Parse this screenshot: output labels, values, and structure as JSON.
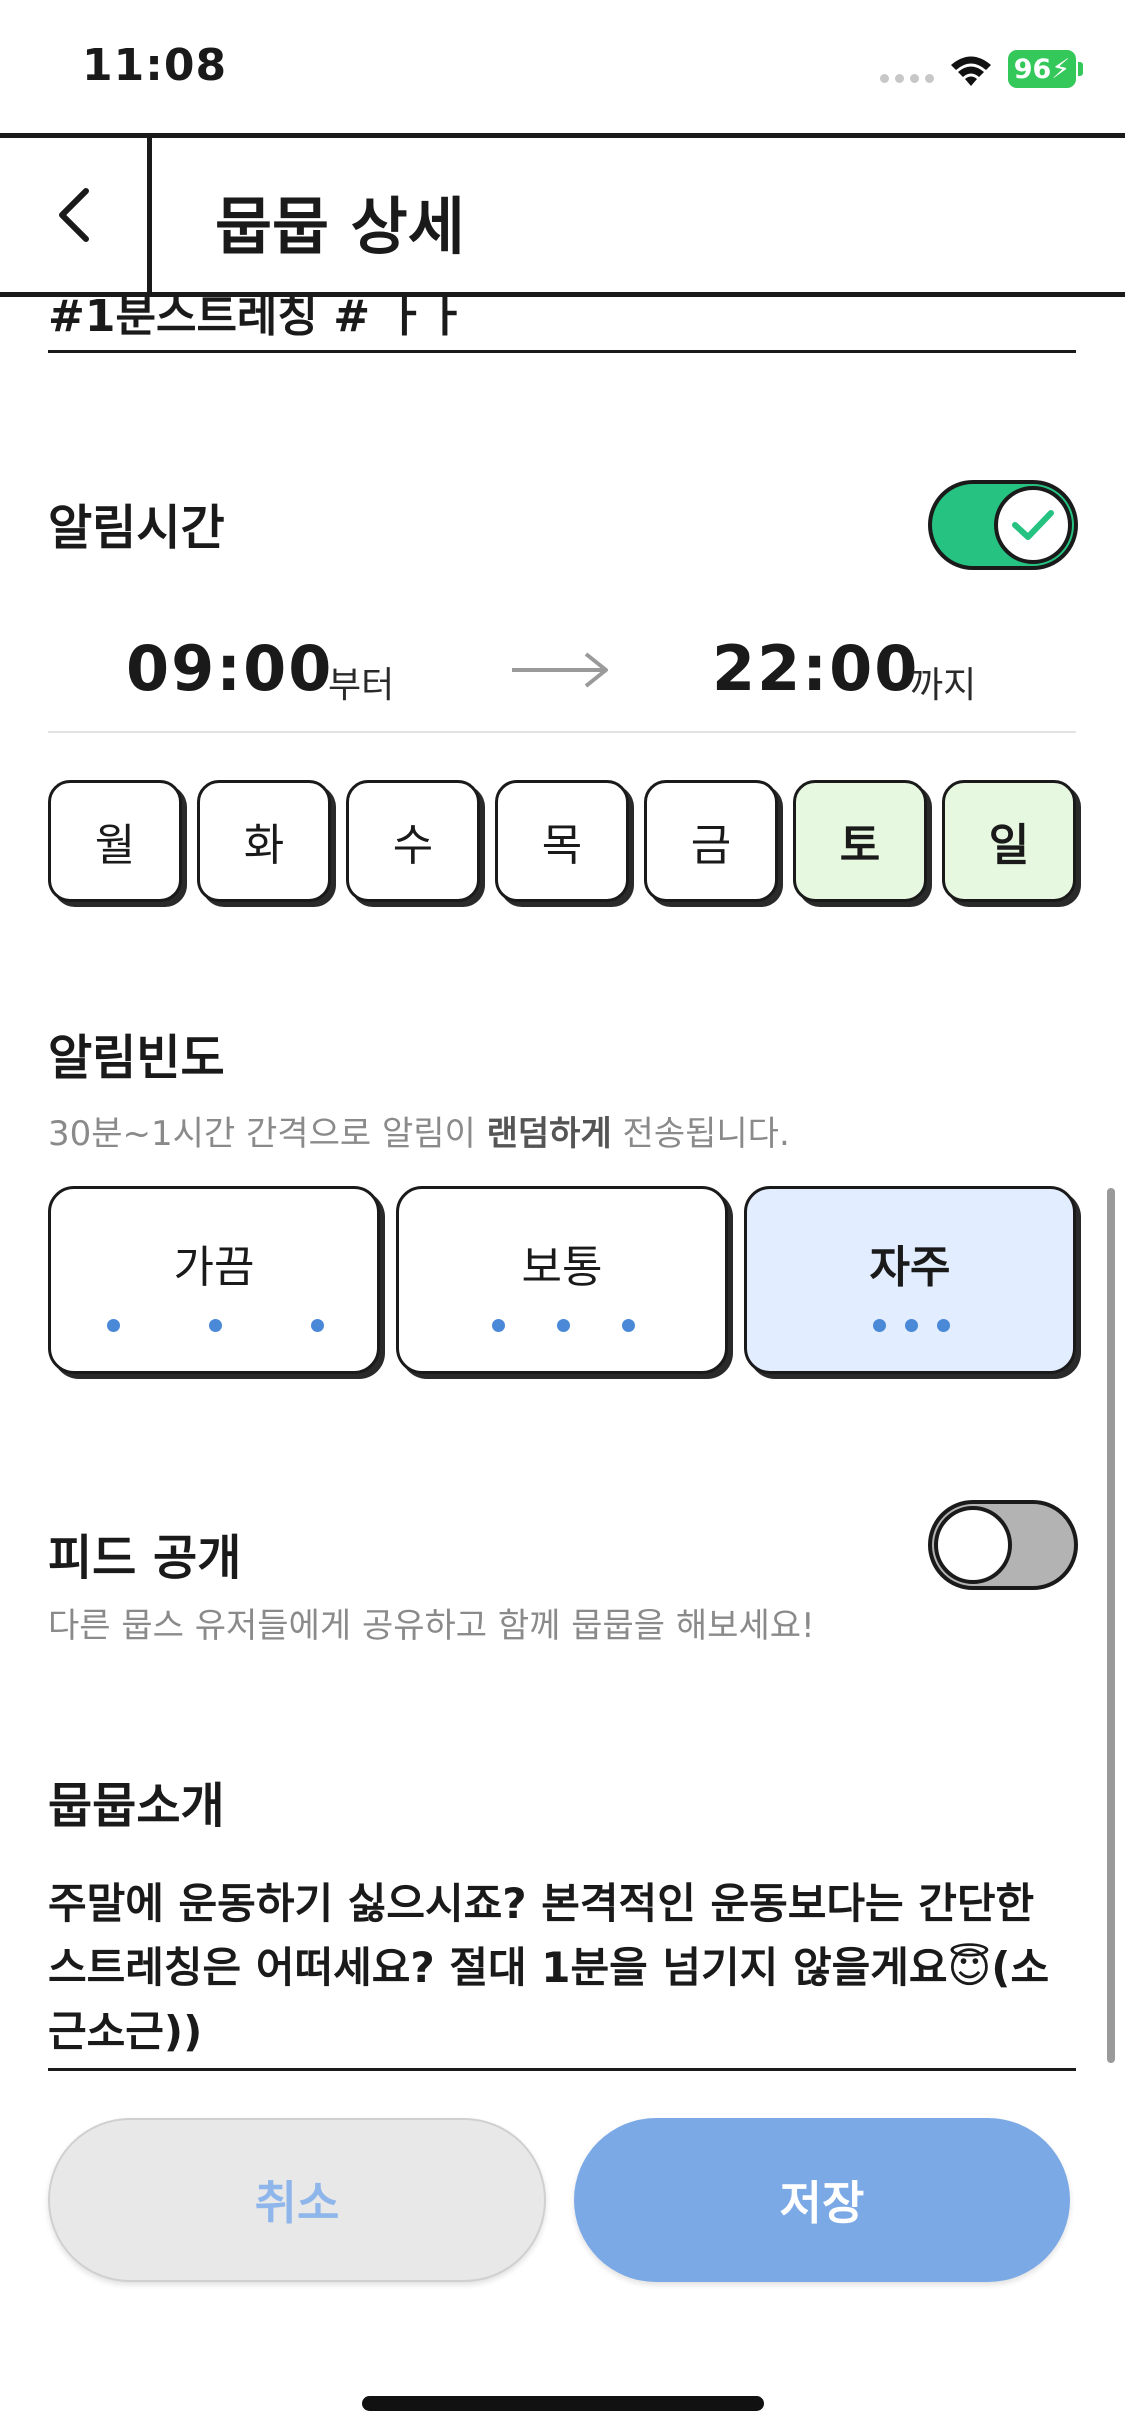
{
  "status_bar": {
    "time": "11:08",
    "battery": "96"
  },
  "header": {
    "title": "뭅뭅 상세"
  },
  "tags_clipped": "#1분스트레칭 # ㅏㅏ",
  "alarm_time": {
    "title": "알림시간",
    "enabled": true,
    "start_time": "09:00",
    "start_suffix": "부터",
    "end_time": "22:00",
    "end_suffix": "까지"
  },
  "weekdays": [
    {
      "label": "월",
      "selected": false
    },
    {
      "label": "화",
      "selected": false
    },
    {
      "label": "수",
      "selected": false
    },
    {
      "label": "목",
      "selected": false
    },
    {
      "label": "금",
      "selected": false
    },
    {
      "label": "토",
      "selected": true
    },
    {
      "label": "일",
      "selected": true
    }
  ],
  "frequency": {
    "title": "알림빈도",
    "desc_prefix": "30분~1시간 간격으로 알림이 ",
    "desc_bold": "랜덤하게",
    "desc_suffix": " 전송됩니다.",
    "options": [
      {
        "label": "가끔",
        "selected": false
      },
      {
        "label": "보통",
        "selected": false
      },
      {
        "label": "자주",
        "selected": true
      }
    ]
  },
  "feed": {
    "title": "피드 공개",
    "desc": "다른 뭅스 유저들에게 공유하고 함께 뭅뭅을 해보세요!",
    "enabled": false
  },
  "intro": {
    "title": "뭅뭅소개",
    "text": "주말에 운동하기 싫으시죠? 본격적인 운동보다는 간단한 스트레칭은 어떠세요? 절대 1분을 넘기지 않을게요😇(소근소근))"
  },
  "buttons": {
    "cancel": "취소",
    "save": "저장"
  },
  "colors": {
    "toggle_on": "#26c281",
    "day_selected": "#e6f8df",
    "freq_selected": "#e2eeff",
    "save": "#7ba9e6",
    "dot": "#4a88d8"
  }
}
